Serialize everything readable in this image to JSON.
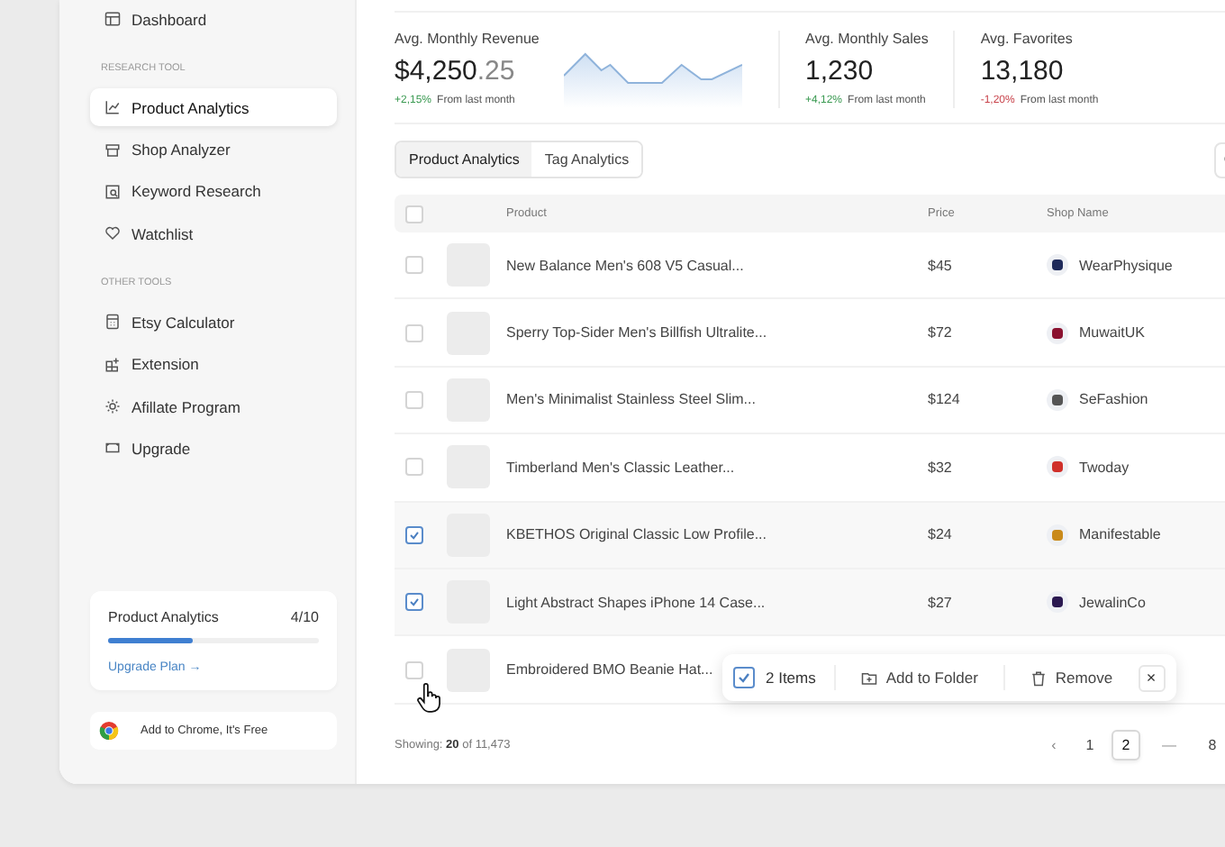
{
  "sidebar": {
    "top_items": [
      {
        "label": "Dashboard",
        "selected": false
      }
    ],
    "sections": [
      {
        "title": "RESEARCH TOOL",
        "items": [
          {
            "label": "Product Analytics",
            "selected": true
          },
          {
            "label": "Shop Analyzer",
            "selected": false
          },
          {
            "label": "Keyword Research",
            "selected": false
          },
          {
            "label": "Watchlist",
            "selected": false
          }
        ]
      },
      {
        "title": "OTHER TOOLS",
        "items": [
          {
            "label": "Etsy Calculator",
            "selected": false
          },
          {
            "label": "Extension",
            "selected": false
          },
          {
            "label": "Afillate Program",
            "selected": false
          },
          {
            "label": "Upgrade",
            "selected": false
          }
        ]
      }
    ],
    "usage": {
      "title": "Product Analytics",
      "count": "4/10",
      "level": 0.4,
      "link": "Upgrade Plan →"
    },
    "chrome_button": "Add to Chrome, It's Free"
  },
  "stats": [
    {
      "kind": "sparkline",
      "label": "Avg. Monthly Revenue",
      "value": "$4,250",
      "fraction": ".25",
      "change": "+2,15%",
      "color": "#3b9a52",
      "note": "From last month"
    },
    {
      "kind": "plain",
      "label": "Avg. Monthly Sales",
      "value": "1,230",
      "change": "+4,12%",
      "color": "#3b9a52",
      "note": "From last month"
    },
    {
      "kind": "plain",
      "label": "Avg. Favorites",
      "value": "13,180",
      "change": "-1,20%",
      "color": "#c8424a",
      "note": "From last month"
    }
  ],
  "tabs": [
    {
      "label": "Product Analytics",
      "selected": true
    },
    {
      "label": "Tag Analytics",
      "selected": false
    }
  ],
  "table": {
    "columns": [
      "Product",
      "Price",
      "Shop Name"
    ],
    "header_checked": false,
    "rows": [
      {
        "checked": false,
        "product": "New Balance Men's 608 V5 Casual...",
        "price": "$45",
        "shop": "WearPhysique",
        "color": "#1e2a5a"
      },
      {
        "checked": false,
        "product": "Sperry Top-Sider Men's Billfish Ultralite...",
        "price": "$72",
        "shop": "MuwaitUK",
        "color": "#8b1230"
      },
      {
        "checked": false,
        "product": "Men's Minimalist Stainless Steel Slim...",
        "price": "$124",
        "shop": "SeFashion",
        "color": "#555555"
      },
      {
        "checked": false,
        "product": "Timberland Men's Classic Leather...",
        "price": "$32",
        "shop": "Twoday",
        "color": "#d0302a"
      },
      {
        "checked": true,
        "product": "KBETHOS Original Classic Low Profile...",
        "price": "$24",
        "shop": "Manifestable",
        "color": "#c98a1a"
      },
      {
        "checked": true,
        "product": "Light Abstract Shapes iPhone 14 Case...",
        "price": "$27",
        "shop": "JewalinCo",
        "color": "#2a1850"
      },
      {
        "checked": false,
        "product": "Embroidered BMO Beanie Hat..."
      }
    ]
  },
  "selection_bar": {
    "checked": true,
    "count": "2 Items",
    "actions": [
      {
        "label": "Add to Folder",
        "kind": "folder"
      },
      {
        "label": "Remove",
        "kind": "trash"
      }
    ],
    "close": "×"
  },
  "footer": {
    "showing": "Showing: **20** of 11,473",
    "pages": [
      {
        "label": "‹",
        "kind": "arrow"
      },
      {
        "label": "1",
        "kind": "page",
        "selected": false
      },
      {
        "label": "2",
        "kind": "page",
        "selected": true
      },
      {
        "label": "—",
        "kind": "gap"
      },
      {
        "label": "8",
        "kind": "page",
        "selected": false
      }
    ]
  }
}
